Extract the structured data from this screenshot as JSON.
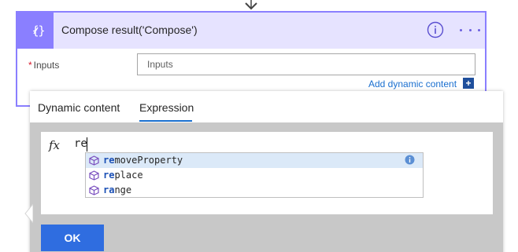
{
  "action": {
    "title": "Compose result('Compose')",
    "icon": "compose-braces-icon",
    "header_color": "#e6e3ff",
    "accent_color": "#8a7fff"
  },
  "inputs": {
    "label": "Inputs",
    "required_marker": "*",
    "placeholder": "Inputs",
    "value": ""
  },
  "add_dynamic": {
    "link_text": "Add dynamic content",
    "plus": "+"
  },
  "popup": {
    "tabs": [
      {
        "label": "Dynamic content",
        "active": false
      },
      {
        "label": "Expression",
        "active": true
      }
    ],
    "fx_label": "fx",
    "expression_value": "re",
    "suggestions": [
      {
        "match": "re",
        "rest": "moveProperty",
        "selected": true
      },
      {
        "match": "re",
        "rest": "place",
        "selected": false
      },
      {
        "match": "ra",
        "rest": "nge",
        "selected": false
      }
    ],
    "ok_label": "OK"
  },
  "colors": {
    "link": "#1a6fcf",
    "ok_button": "#2f6de0",
    "panel_gray": "#c8c8c8"
  }
}
